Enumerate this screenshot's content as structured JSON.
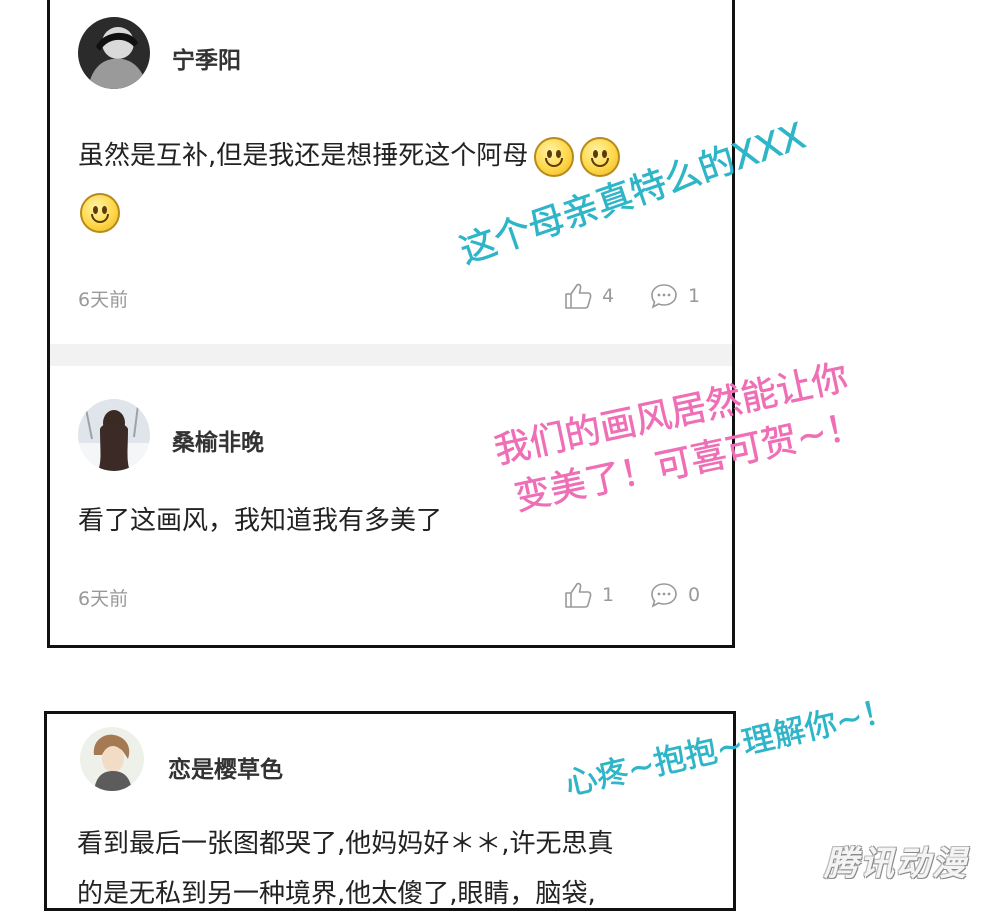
{
  "comments": [
    {
      "username": "宁季阳",
      "text": "虽然是互补,但是我还是想捶死这个阿母",
      "emoji_count": 3,
      "emoji": "smile-emoji",
      "time": "6天前",
      "likes": "4",
      "replies": "1"
    },
    {
      "username": "桑榆非晚",
      "text": "看了这画风，我知道我有多美了",
      "time": "6天前",
      "likes": "1",
      "replies": "0"
    },
    {
      "username": "恋是樱草色",
      "text_line1": "看到最后一张图都哭了,他妈妈好＊＊,许无思真",
      "text_line2": "的是无私到另一种境界,他太傻了,眼睛，脑袋,"
    }
  ],
  "annotations": {
    "note1": "这个母亲真特么的XXX",
    "note2_line1": "我们的画风居然能让你",
    "note2_line2": "变美了！可喜可贺~！",
    "note3": "心疼~抱抱~理解你~！"
  },
  "watermark": "腾讯动漫",
  "colors": {
    "annotation_cyan": "#2fb5c8",
    "annotation_pink": "#ef6fb6",
    "meta_gray": "#999999",
    "border": "#111111"
  }
}
